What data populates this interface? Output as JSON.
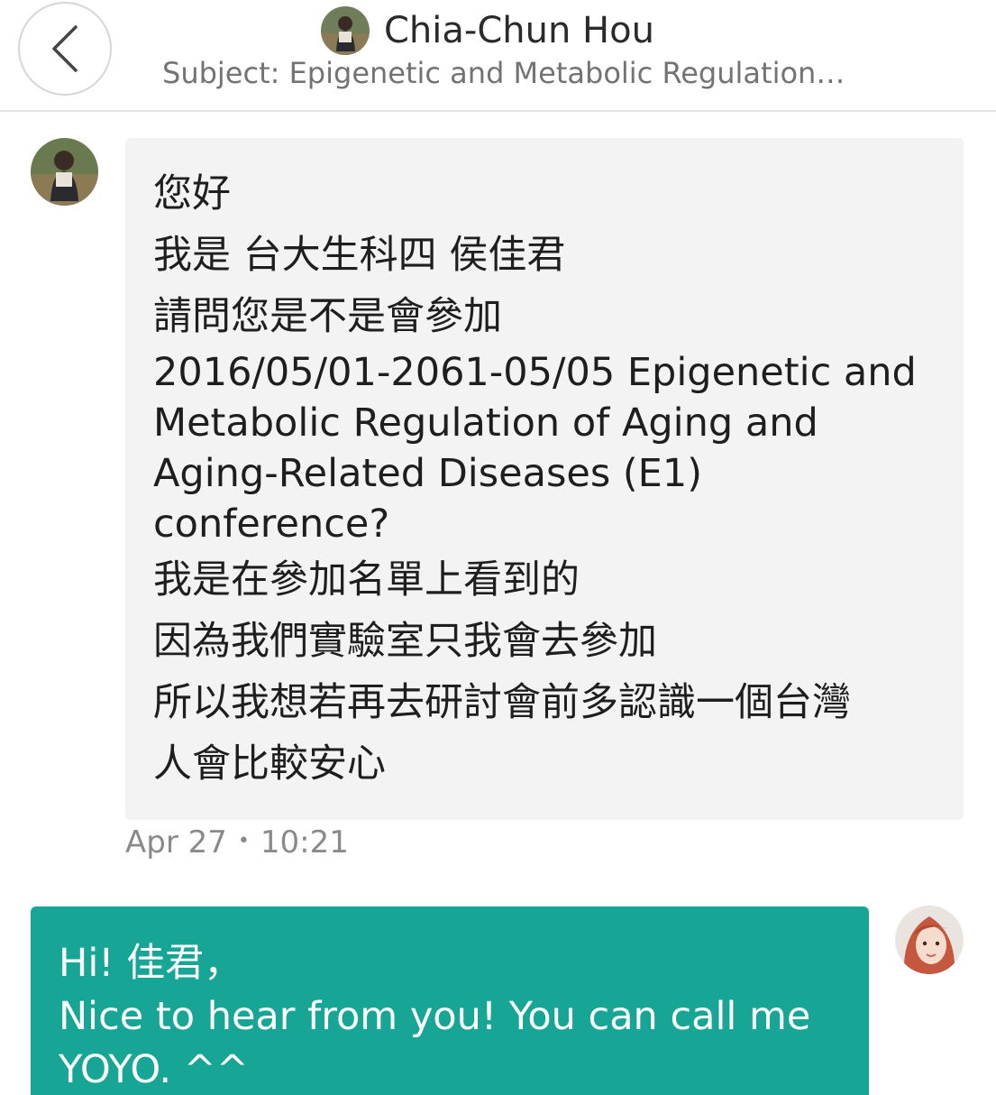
{
  "header": {
    "back_icon": "chevron-left-icon",
    "name": "Chia-Chun Hou",
    "subject": "Subject: Epigenetic and Metabolic Regulation…"
  },
  "incoming": {
    "lines": [
      "您好",
      "我是 台大生科四 侯佳君",
      "請問您是不是會參加",
      "2016/05/01-2061-05/05 Epigenetic and",
      "Metabolic Regulation of Aging and",
      "Aging-Related Diseases (E1)",
      "conference?",
      "我是在參加名單上看到的",
      "因為我們實驗室只我會去參加",
      "所以我想若再去研討會前多認識一個台灣",
      "人會比較安心"
    ],
    "date": "Apr 27",
    "separator": "•",
    "time": "10:21"
  },
  "outgoing": {
    "lines": [
      "Hi! 佳君，",
      "Nice to hear from you! You can call me",
      "YOYO. ^^"
    ]
  },
  "colors": {
    "incoming_bubble": "#f3f3f3",
    "outgoing_bubble": "#17a596",
    "header_border": "#e3e3e3"
  }
}
